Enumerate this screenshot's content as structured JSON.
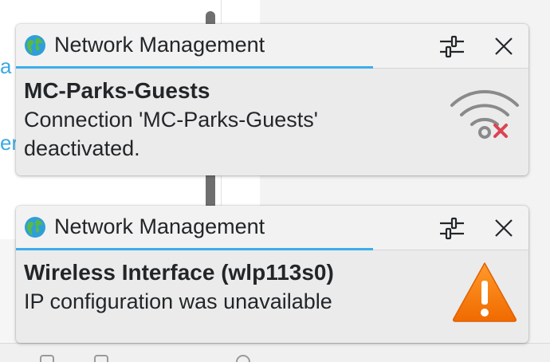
{
  "background": {
    "link_fragment_1": "a",
    "link_fragment_2": "er"
  },
  "notifications": [
    {
      "app_name": "Network Management",
      "app_icon": "globe-icon",
      "title": "MC-Parks-Guests",
      "body_line_1": "Connection 'MC-Parks-Guests'",
      "body_line_2": "deactivated.",
      "status_icon": "wifi-disconnected-icon",
      "accent_color": "#3daee9",
      "error_color": "#da4453"
    },
    {
      "app_name": "Network Management",
      "app_icon": "globe-icon",
      "title": "Wireless Interface (wlp113s0)",
      "body_line_1": "IP configuration was unavailable",
      "status_icon": "warning-icon",
      "accent_color": "#3daee9",
      "warning_color": "#f67400"
    }
  ]
}
